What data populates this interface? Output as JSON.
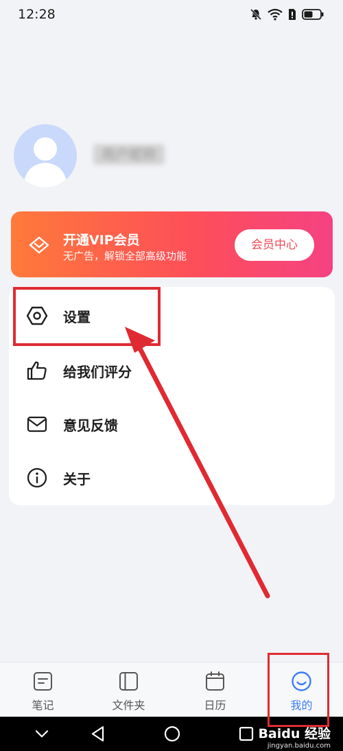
{
  "status_bar": {
    "time": "12:28"
  },
  "profile": {
    "username": "用户昵称"
  },
  "vip": {
    "title": "开通VIP会员",
    "subtitle": "无广告，解锁全部高级功能",
    "button_label": "会员中心"
  },
  "menu": {
    "items": [
      {
        "label": "设置",
        "icon": "settings-hexagon-icon"
      },
      {
        "label": "给我们评分",
        "icon": "thumbs-up-icon"
      },
      {
        "label": "意见反馈",
        "icon": "envelope-icon"
      },
      {
        "label": "关于",
        "icon": "info-icon"
      }
    ]
  },
  "bottom_nav": {
    "tabs": [
      {
        "label": "笔记",
        "icon": "note-icon"
      },
      {
        "label": "文件夹",
        "icon": "folder-icon"
      },
      {
        "label": "日历",
        "icon": "calendar-icon"
      },
      {
        "label": "我的",
        "icon": "smile-icon",
        "active": true
      }
    ]
  },
  "watermark": {
    "main": "Baidu 经验",
    "sub": "jingyan.baidu.com"
  },
  "colors": {
    "accent": "#3d7cf4",
    "annotation_red": "#e02a32",
    "vip_gradient_start": "#ff7a3a",
    "vip_gradient_end": "#f54282"
  }
}
